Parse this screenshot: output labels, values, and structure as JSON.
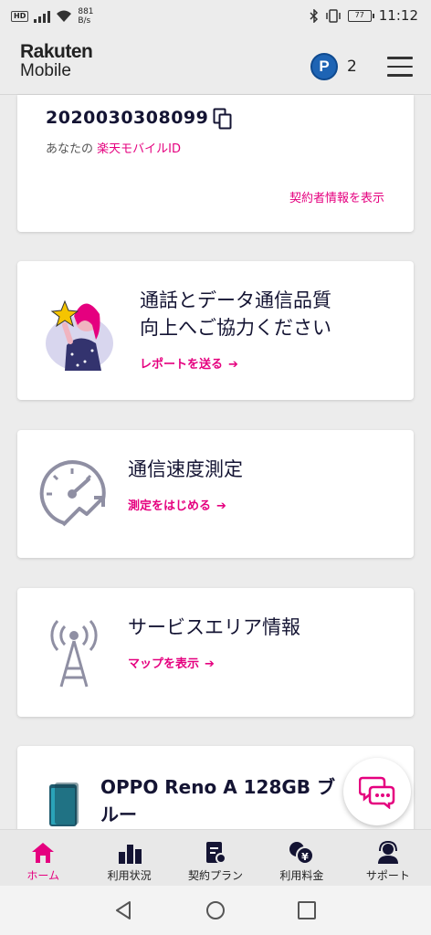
{
  "status_bar": {
    "hd": "HD",
    "net_speed": "881",
    "net_unit": "B/s",
    "battery": "77",
    "time": "11:12"
  },
  "header": {
    "logo_top": "Rakuten",
    "logo_bottom": "Mobile",
    "points_icon_letter": "P",
    "points_count": "2"
  },
  "id_card": {
    "id_number": "2020030308099",
    "label_prefix": "あなたの",
    "label_link": "楽天モバイルID",
    "contract_link": "契約者情報を表示"
  },
  "quality_card": {
    "title_line1": "通話とデータ通信品質",
    "title_line2": "向上へご協力ください",
    "link": "レポートを送る"
  },
  "speed_card": {
    "title": "通信速度測定",
    "link": "測定をはじめる"
  },
  "area_card": {
    "title": "サービスエリア情報",
    "link": "マップを表示"
  },
  "device_card": {
    "name_line1": "OPPO Reno A 128GB ブ",
    "name_line2": "ルー"
  },
  "bottom_nav": {
    "items": [
      {
        "label": "ホーム"
      },
      {
        "label": "利用状況"
      },
      {
        "label": "契約プラン"
      },
      {
        "label": "利用料金"
      },
      {
        "label": "サポート"
      }
    ]
  },
  "colors": {
    "accent": "#e5007f",
    "text_dark": "#141433",
    "icon_gray": "#8f8fa3"
  }
}
